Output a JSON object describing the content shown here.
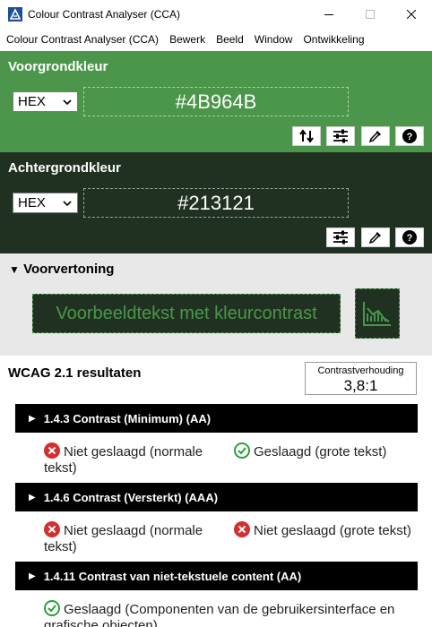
{
  "window": {
    "title": "Colour Contrast Analyser (CCA)"
  },
  "menu": {
    "items": [
      "Colour Contrast Analyser (CCA)",
      "Bewerk",
      "Beeld",
      "Window",
      "Ontwikkeling"
    ]
  },
  "foreground": {
    "title": "Voorgrondkleur",
    "format": "HEX",
    "value": "#4B964B",
    "color": "#4b964b"
  },
  "background": {
    "title": "Achtergrondkleur",
    "format": "HEX",
    "value": "#213121",
    "color": "#213121"
  },
  "preview": {
    "title": "Voorvertoning",
    "sample_text": "Voorbeeldtekst met kleurcontrast"
  },
  "results": {
    "title": "WCAG 2.1 resultaten",
    "ratio_label": "Contrastverhouding",
    "ratio_value": "3,8:1",
    "criteria": [
      {
        "title": "1.4.3 Contrast (Minimum) (AA)",
        "items": [
          {
            "status": "fail",
            "line1": "Niet geslaagd (normale",
            "line2": "tekst)"
          },
          {
            "status": "pass",
            "line1": "Geslaagd (grote tekst)",
            "line2": ""
          }
        ]
      },
      {
        "title": "1.4.6 Contrast (Versterkt) (AAA)",
        "items": [
          {
            "status": "fail",
            "line1": "Niet geslaagd (normale",
            "line2": "tekst)"
          },
          {
            "status": "fail",
            "line1": "Niet geslaagd (grote tekst)",
            "line2": ""
          }
        ]
      },
      {
        "title": "1.4.11 Contrast van niet-tekstuele content (AA)",
        "items": [
          {
            "status": "pass",
            "line1": "Geslaagd (Componenten van de gebruikersinterface en",
            "line2": "grafische objecten)"
          }
        ]
      }
    ]
  },
  "colors": {
    "fail": "#d32f2f",
    "pass": "#2e9d3a"
  }
}
